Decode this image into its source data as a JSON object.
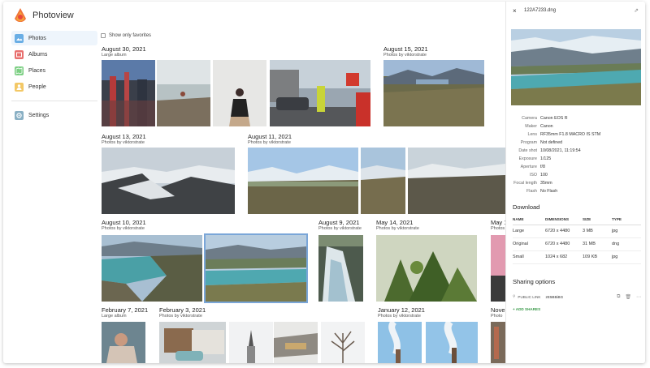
{
  "app": {
    "title": "Photoview"
  },
  "sidebar": {
    "items": [
      {
        "label": "Photos",
        "icon": "photos-icon",
        "color": "#6aaee5",
        "active": true
      },
      {
        "label": "Albums",
        "icon": "albums-icon",
        "color": "#e8706f"
      },
      {
        "label": "Places",
        "icon": "places-icon",
        "color": "#7ccf83"
      },
      {
        "label": "People",
        "icon": "people-icon",
        "color": "#f3c866"
      }
    ],
    "settings": {
      "label": "Settings",
      "icon": "settings-icon",
      "color": "#8ab0c4"
    }
  },
  "filter": {
    "show_favorites": "Show only favorites"
  },
  "albums": [
    {
      "date": "August 30, 2021",
      "subtitle": "Large album"
    },
    {
      "date": "August 15, 2021",
      "subtitle": "Photos by viktorstrate"
    },
    {
      "date": "August 13, 2021",
      "subtitle": "Photos by viktorstrate"
    },
    {
      "date": "August 11, 2021",
      "subtitle": "Photos by viktorstrate"
    },
    {
      "date": "August 10, 2021",
      "subtitle": "Photos by viktorstrate"
    },
    {
      "date": "August 9, 2021",
      "subtitle": "Photos by viktorstrate"
    },
    {
      "date": "May 14, 2021",
      "subtitle": "Photos by viktorstrate"
    },
    {
      "date": "May 1",
      "subtitle": "Photos"
    },
    {
      "date": "February 7, 2021",
      "subtitle": "Large album"
    },
    {
      "date": "February 3, 2021",
      "subtitle": "Photos by viktorstrate"
    },
    {
      "date": "January 12, 2021",
      "subtitle": "Photos by viktorstrate"
    },
    {
      "date": "Nove",
      "subtitle": "Photo"
    }
  ],
  "panel": {
    "close": "×",
    "filename": "122A7233.dng",
    "link_icon": "⇗",
    "exif": [
      {
        "label": "Camera",
        "value": "Canon EOS R"
      },
      {
        "label": "Maker",
        "value": "Canon"
      },
      {
        "label": "Lens",
        "value": "RF35mm F1.8 MACRO IS STM"
      },
      {
        "label": "Program",
        "value": "Not defined"
      },
      {
        "label": "Date shot",
        "value": "10/08/2021, 11:19:54"
      },
      {
        "label": "Exposure",
        "value": "1/125"
      },
      {
        "label": "Aperture",
        "value": "f/8"
      },
      {
        "label": "ISO",
        "value": "100"
      },
      {
        "label": "Focal length",
        "value": "35mm"
      },
      {
        "label": "Flash",
        "value": "No Flash"
      }
    ],
    "download": {
      "title": "Download",
      "headers": [
        "NAME",
        "DIMENSIONS",
        "SIZE",
        "TYPE"
      ],
      "rows": [
        [
          "Large",
          "6720 x 4480",
          "3 MB",
          "jpg"
        ],
        [
          "Original",
          "6720 x 4480",
          "31 MB",
          "dng"
        ],
        [
          "Small",
          "1024 x 682",
          "109 KB",
          "jpg"
        ]
      ]
    },
    "sharing": {
      "title": "Sharing options",
      "public_link": "PUBLIC LINK",
      "token": "zE5BBiBG",
      "add_shares": "+ ADD SHARES"
    }
  }
}
